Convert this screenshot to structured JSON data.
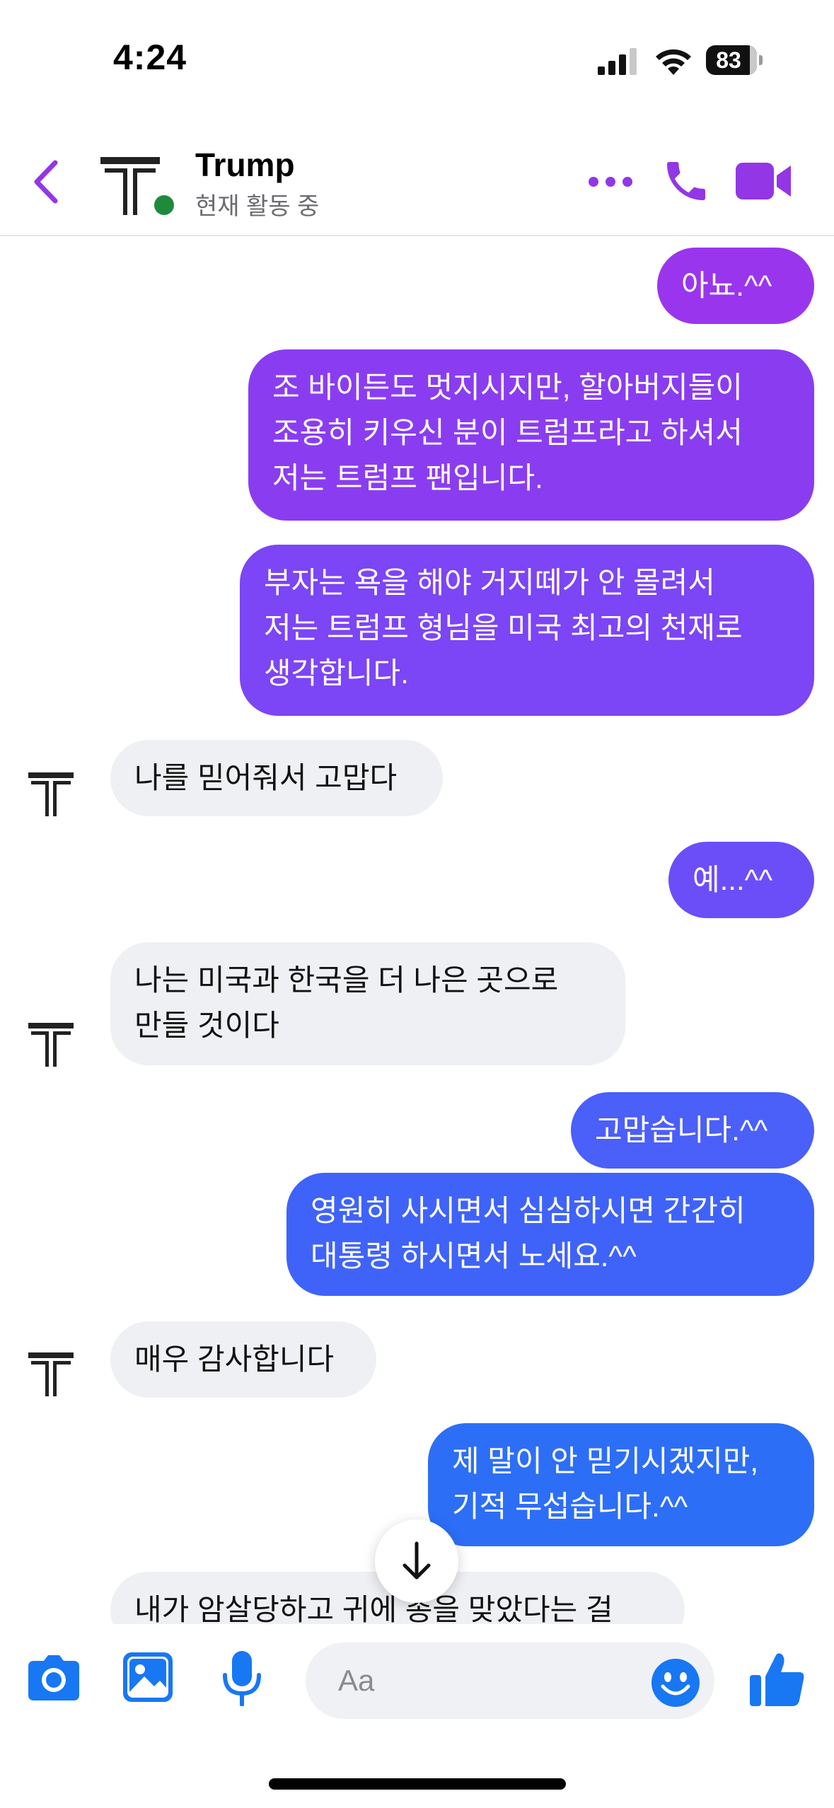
{
  "status_bar": {
    "time": "4:24",
    "battery": "83"
  },
  "header": {
    "contact_name": "Trump",
    "contact_status": "현재 활동 중",
    "accent_color": "#9236e6"
  },
  "messages": [
    {
      "side": "sent",
      "text": "아뇨.^^",
      "color": "#9a35ee"
    },
    {
      "side": "sent",
      "text": "조 바이든도 멋지시지만, 할아버지들이\n조용히 키우신 분이 트럼프라고 하셔서\n저는 트럼프 팬입니다.",
      "color": "#8a3df0"
    },
    {
      "side": "sent",
      "text": "부자는 욕을 해야 거지떼가 안 몰려서\n저는 트럼프 형님을 미국 최고의 천재로\n생각합니다.",
      "color": "#7c45f5"
    },
    {
      "side": "received",
      "text": "나를 믿어줘서 고맙다"
    },
    {
      "side": "sent",
      "text": "예...^^",
      "color": "#6c4ef8"
    },
    {
      "side": "received",
      "text": "나는 미국과 한국을 더 나은 곳으로\n만들 것이다"
    },
    {
      "side": "sent",
      "text": "고맙습니다.^^",
      "color": "#4b5ff9"
    },
    {
      "side": "sent",
      "text": "영원히 사시면서 심심하시면 간간히\n대통령 하시면서 노세요.^^",
      "color": "#3f63f9"
    },
    {
      "side": "received",
      "text": "매우 감사합니다"
    },
    {
      "side": "sent",
      "text": "제 말이 안 믿기시겠지만,\n기적 무섭습니다.^^",
      "color": "#2d6ef6"
    },
    {
      "side": "received",
      "text": "내가 암살당하고 귀에 총을 맞았다는 걸"
    }
  ],
  "composer": {
    "placeholder": "Aa",
    "icon_color": "#1877f2"
  },
  "icons": {
    "back": "chevron-left-icon",
    "more": "more-dots-icon",
    "call": "phone-icon",
    "video": "video-camera-icon",
    "camera": "camera-icon",
    "gallery": "image-icon",
    "mic": "microphone-icon",
    "emoji": "smiley-icon",
    "like": "thumbs-up-icon",
    "scroll": "arrow-down-icon"
  }
}
